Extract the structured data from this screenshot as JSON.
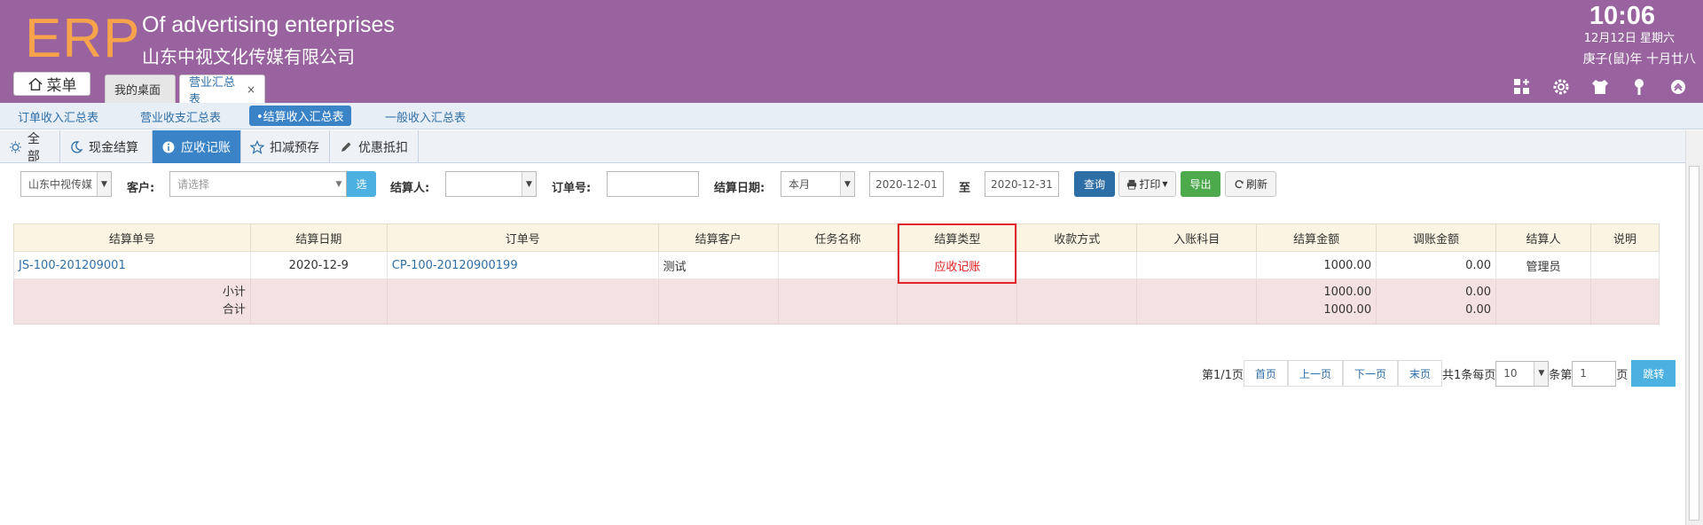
{
  "header": {
    "logo": "ERP",
    "brand_en": "Of advertising enterprises",
    "brand_cn": "山东中视文化传媒有限公司",
    "time": "10:06",
    "date": "12月12日 星期六",
    "lunar": "庚子(鼠)年 十月廿八",
    "menu_label": "菜单",
    "tabs": [
      {
        "label": "我的桌面"
      },
      {
        "label": "营业汇总表",
        "close": "×"
      }
    ]
  },
  "subnav": {
    "items": [
      "订单收入汇总表",
      "营业收支汇总表",
      "•结算收入汇总表",
      "一般收入汇总表"
    ]
  },
  "typebar": {
    "items": [
      "全部",
      "现金结算",
      "应收记账",
      "扣减预存",
      "优惠抵扣"
    ],
    "active": "应收记账"
  },
  "filters": {
    "company": "山东中视传媒",
    "customer_label": "客户:",
    "customer_placeholder": "请选择",
    "pick_label": "选",
    "settler_label": "结算人:",
    "order_label": "订单号:",
    "date_label": "结算日期:",
    "period": "本月",
    "date_from": "2020-12-01",
    "to_label": "至",
    "date_to": "2020-12-31",
    "query": "查询",
    "print": "打印",
    "export": "导出",
    "refresh": "刷新"
  },
  "table": {
    "headers": [
      "结算单号",
      "结算日期",
      "订单号",
      "结算客户",
      "任务名称",
      "结算类型",
      "收款方式",
      "入账科目",
      "结算金额",
      "调账金额",
      "结算人",
      "说明"
    ],
    "row": {
      "no": "JS-100-201209001",
      "date": "2020-12-9",
      "order": "CP-100-20120900199",
      "customer": "测试",
      "task": "",
      "type": "应收记账",
      "pay": "",
      "account": "",
      "amount": "1000.00",
      "adjust": "0.00",
      "settler": "管理员",
      "note": ""
    },
    "subtotal_label": "小计",
    "total_label": "合计",
    "subtotal_amount": "1000.00",
    "subtotal_adjust": "0.00",
    "total_amount": "1000.00",
    "total_adjust": "0.00"
  },
  "pager": {
    "page_info": "第1/1页",
    "first": "首页",
    "prev": "上一页",
    "next": "下一页",
    "last": "末页",
    "count_text": "共1条每页",
    "page_size": "10",
    "goto_prefix": "条第",
    "goto_value": "1",
    "goto_suffix": "页",
    "jump": "跳转"
  },
  "colors": {
    "header_bg": "#98639e",
    "logo": "#f7a34b",
    "accent": "#3a83c6",
    "highlight": "#e0252b"
  }
}
